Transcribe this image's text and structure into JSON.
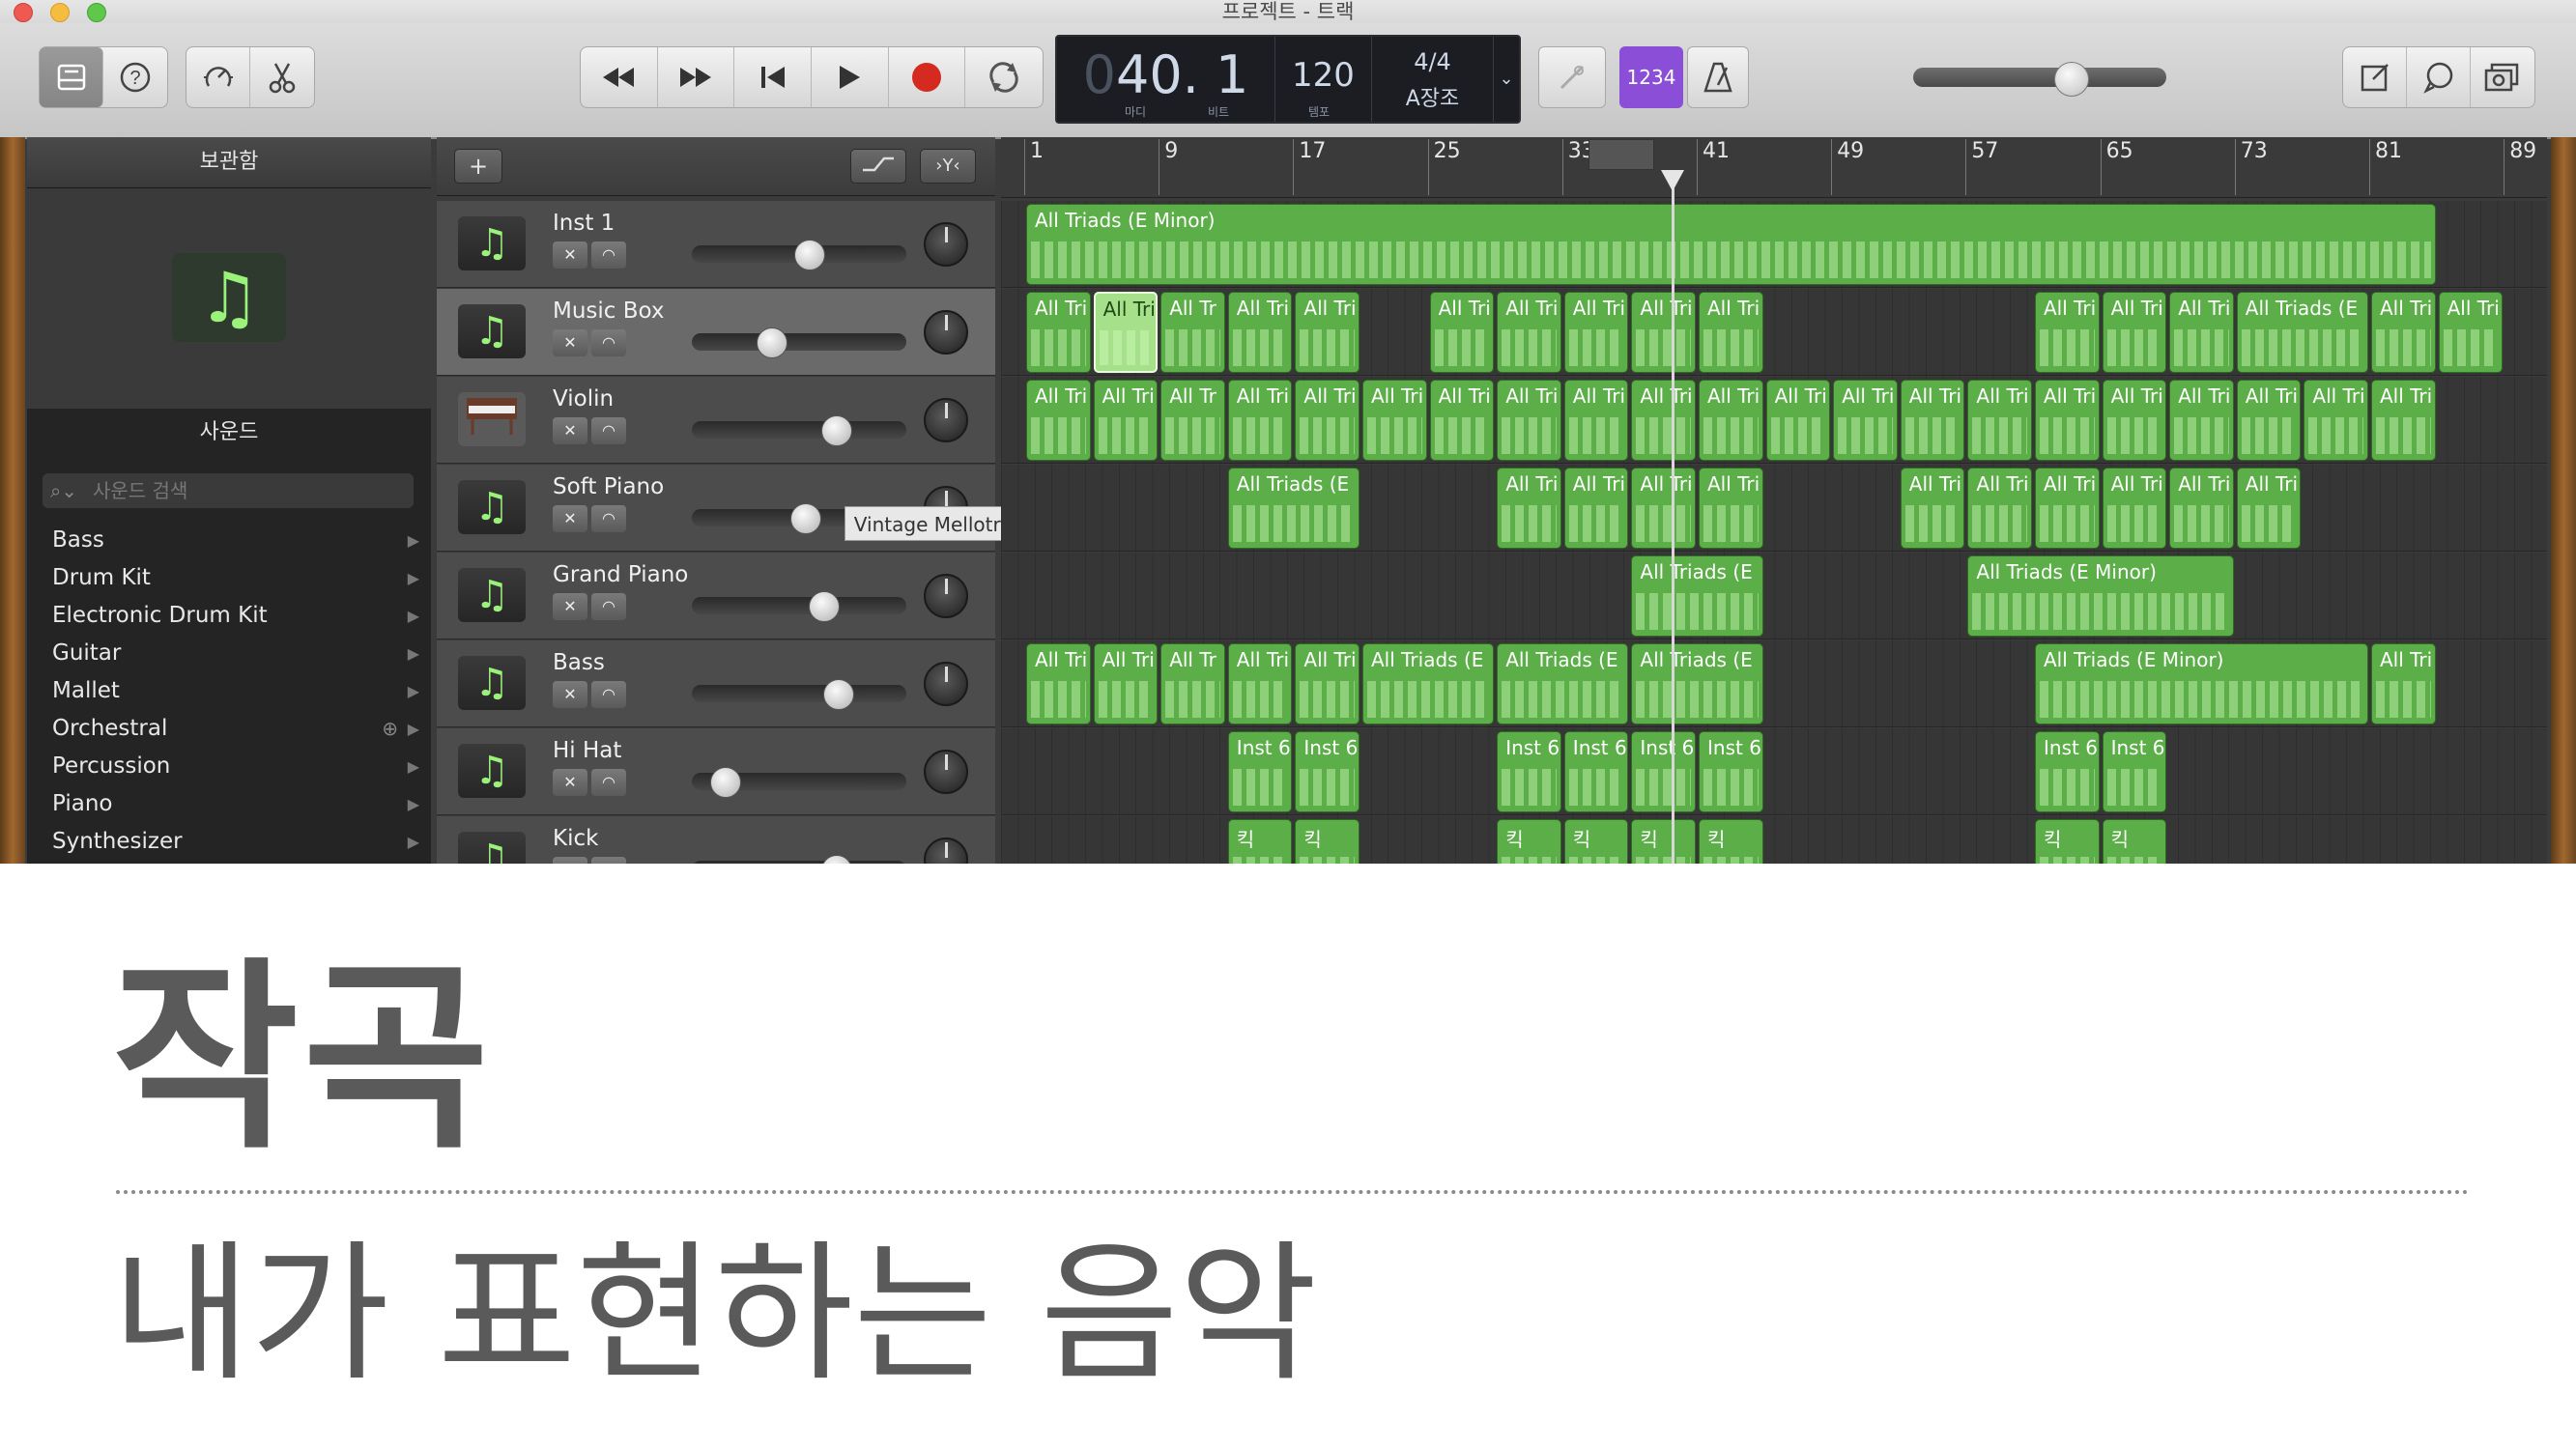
{
  "window": {
    "title": "프로젝트 - 트랙"
  },
  "toolbar": {
    "lcd": {
      "bar": "40",
      "beat": "1",
      "bar_label": "마디",
      "beat_label": "비트",
      "tempo": "120",
      "tempo_label": "템포",
      "time_signature": "4/4",
      "key": "A장조"
    },
    "count_in_label": "1234",
    "icons": [
      "library-icon",
      "help-icon",
      "smart-controls-icon",
      "editors-icon",
      "rewind-icon",
      "fast-forward-icon",
      "go-to-start-icon",
      "play-icon",
      "record-icon",
      "cycle-icon",
      "tuner-icon",
      "metronome-icon",
      "notepad-icon",
      "loop-browser-icon",
      "media-browser-icon"
    ],
    "master_volume": 0.64,
    "colors": {
      "record": "#d42a1f",
      "count_in": "#8a4fd6",
      "region": "#5cae48"
    }
  },
  "library": {
    "header": "보관함",
    "sounds_header": "사운드",
    "search_placeholder": "사운드 검색",
    "categories": [
      {
        "label": "Bass"
      },
      {
        "label": "Drum Kit"
      },
      {
        "label": "Electronic Drum Kit"
      },
      {
        "label": "Guitar"
      },
      {
        "label": "Mallet"
      },
      {
        "label": "Orchestral"
      },
      {
        "label": "Percussion"
      },
      {
        "label": "Piano"
      },
      {
        "label": "Synthesizer"
      }
    ]
  },
  "tracks": [
    {
      "name": "Inst 1",
      "volume": 0.55
    },
    {
      "name": "Music Box",
      "volume": 0.35
    },
    {
      "name": "Violin",
      "volume": 0.7
    },
    {
      "name": "Soft Piano",
      "volume": 0.53
    },
    {
      "name": "Grand Piano",
      "volume": 0.63
    },
    {
      "name": "Bass",
      "volume": 0.71
    },
    {
      "name": "Hi Hat",
      "volume": 0.1
    },
    {
      "name": "Kick",
      "volume": 0.7
    }
  ],
  "tooltip": "Vintage Mellotron",
  "ruler": {
    "marks": [
      "1",
      "9",
      "17",
      "25",
      "33",
      "41",
      "49",
      "57",
      "65",
      "73",
      "81",
      "89"
    ]
  },
  "regions": [
    [
      {
        "label": "All Triads (E Minor)",
        "start": 1,
        "len": 84
      }
    ],
    [
      {
        "label": "All Tri",
        "start": 1,
        "len": 4
      },
      {
        "label": "All Tri",
        "start": 5,
        "len": 4,
        "selected": true
      },
      {
        "label": "All Tr",
        "start": 9,
        "len": 4
      },
      {
        "label": "All Tri",
        "start": 13,
        "len": 4
      },
      {
        "label": "All Tri",
        "start": 17,
        "len": 4
      },
      {
        "label": "All Tri",
        "start": 25,
        "len": 4
      },
      {
        "label": "All Tri",
        "start": 29,
        "len": 4
      },
      {
        "label": "All Tri",
        "start": 33,
        "len": 4
      },
      {
        "label": "All Tri",
        "start": 37,
        "len": 4
      },
      {
        "label": "All Tri",
        "start": 41,
        "len": 4
      },
      {
        "label": "All Tri",
        "start": 61,
        "len": 4
      },
      {
        "label": "All Tri",
        "start": 65,
        "len": 4
      },
      {
        "label": "All Tri",
        "start": 69,
        "len": 4
      },
      {
        "label": "All Triads (E",
        "start": 73,
        "len": 8
      },
      {
        "label": "All Tri",
        "start": 81,
        "len": 4
      },
      {
        "label": "All Tri",
        "start": 85,
        "len": 4
      }
    ],
    [
      {
        "label": "All Tri",
        "start": 1,
        "len": 4
      },
      {
        "label": "All Tri",
        "start": 5,
        "len": 4
      },
      {
        "label": "All Tr",
        "start": 9,
        "len": 4
      },
      {
        "label": "All Tri",
        "start": 13,
        "len": 4
      },
      {
        "label": "All Tri",
        "start": 17,
        "len": 4
      },
      {
        "label": "All Tri",
        "start": 21,
        "len": 4
      },
      {
        "label": "All Tri",
        "start": 25,
        "len": 4
      },
      {
        "label": "All Tri",
        "start": 29,
        "len": 4
      },
      {
        "label": "All Tri",
        "start": 33,
        "len": 4
      },
      {
        "label": "All Tri",
        "start": 37,
        "len": 4
      },
      {
        "label": "All Tri",
        "start": 41,
        "len": 4
      },
      {
        "label": "All Tri",
        "start": 45,
        "len": 4
      },
      {
        "label": "All Tri",
        "start": 49,
        "len": 4
      },
      {
        "label": "All Tri",
        "start": 53,
        "len": 4
      },
      {
        "label": "All Tri",
        "start": 57,
        "len": 4
      },
      {
        "label": "All Tri",
        "start": 61,
        "len": 4
      },
      {
        "label": "All Tri",
        "start": 65,
        "len": 4
      },
      {
        "label": "All Tri",
        "start": 69,
        "len": 4
      },
      {
        "label": "All Tri",
        "start": 73,
        "len": 4
      },
      {
        "label": "All Tri",
        "start": 77,
        "len": 4
      },
      {
        "label": "All Tri",
        "start": 81,
        "len": 4
      }
    ],
    [
      {
        "label": "All Triads (E",
        "start": 13,
        "len": 8
      },
      {
        "label": "All Tri",
        "start": 29,
        "len": 4
      },
      {
        "label": "All Tri",
        "start": 33,
        "len": 4
      },
      {
        "label": "All Tri",
        "start": 37,
        "len": 4
      },
      {
        "label": "All Tri",
        "start": 41,
        "len": 4
      },
      {
        "label": "All Tri",
        "start": 53,
        "len": 4
      },
      {
        "label": "All Tri",
        "start": 57,
        "len": 4
      },
      {
        "label": "All Tri",
        "start": 61,
        "len": 4
      },
      {
        "label": "All Tri",
        "start": 65,
        "len": 4
      },
      {
        "label": "All Tri",
        "start": 69,
        "len": 4
      },
      {
        "label": "All Tri",
        "start": 73,
        "len": 4
      }
    ],
    [
      {
        "label": "All Triads (E",
        "start": 37,
        "len": 8
      },
      {
        "label": "All Triads (E Minor)",
        "start": 57,
        "len": 16
      }
    ],
    [
      {
        "label": "All Tri",
        "start": 1,
        "len": 4
      },
      {
        "label": "All Tri",
        "start": 5,
        "len": 4
      },
      {
        "label": "All Tr",
        "start": 9,
        "len": 4
      },
      {
        "label": "All Tri",
        "start": 13,
        "len": 4
      },
      {
        "label": "All Tri",
        "start": 17,
        "len": 4
      },
      {
        "label": "All Triads (E",
        "start": 21,
        "len": 8
      },
      {
        "label": "All Triads (E",
        "start": 29,
        "len": 8
      },
      {
        "label": "All Triads (E",
        "start": 37,
        "len": 8
      },
      {
        "label": "All Triads (E Minor)",
        "start": 61,
        "len": 20
      },
      {
        "label": "All Tri",
        "start": 81,
        "len": 4
      }
    ],
    [
      {
        "label": "Inst 6",
        "start": 13,
        "len": 4
      },
      {
        "label": "Inst 6",
        "start": 17,
        "len": 4
      },
      {
        "label": "Inst 6",
        "start": 29,
        "len": 4
      },
      {
        "label": "Inst 6",
        "start": 33,
        "len": 4
      },
      {
        "label": "Inst 6",
        "start": 37,
        "len": 4
      },
      {
        "label": "Inst 6",
        "start": 41,
        "len": 4
      },
      {
        "label": "Inst 6",
        "start": 61,
        "len": 4
      },
      {
        "label": "Inst 6",
        "start": 65,
        "len": 4
      }
    ],
    [
      {
        "label": "킥",
        "start": 13,
        "len": 4
      },
      {
        "label": "킥",
        "start": 17,
        "len": 4
      },
      {
        "label": "킥",
        "start": 29,
        "len": 4
      },
      {
        "label": "킥",
        "start": 33,
        "len": 4
      },
      {
        "label": "킥",
        "start": 37,
        "len": 4
      },
      {
        "label": "킥",
        "start": 41,
        "len": 4
      },
      {
        "label": "킥",
        "start": 61,
        "len": 4
      },
      {
        "label": "킥",
        "start": 65,
        "len": 4
      }
    ]
  ],
  "slide": {
    "title": "작곡",
    "subtitle": "내가 표현하는 음악"
  }
}
